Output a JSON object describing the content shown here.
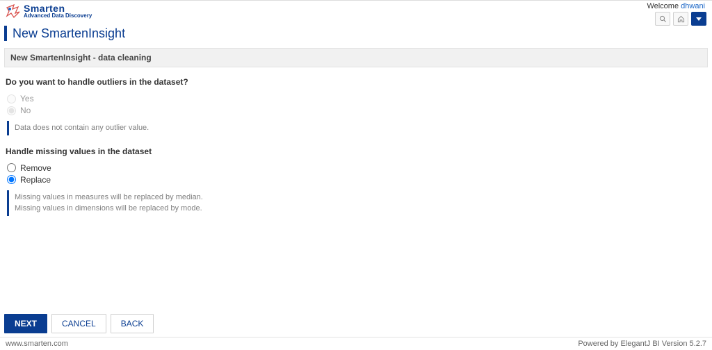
{
  "header": {
    "brand_name": "Smarten",
    "brand_tag": "Advanced Data Discovery",
    "welcome_prefix": "Welcome ",
    "username": "dhwani"
  },
  "page": {
    "title": "New SmartenInsight",
    "section_title": "New SmartenInsight - data cleaning"
  },
  "outliers": {
    "question": "Do you want to handle outliers in the dataset?",
    "options": {
      "yes": "Yes",
      "no": "No"
    },
    "selected": "no",
    "info": "Data does not contain any outlier value."
  },
  "missing": {
    "question": "Handle missing values in the dataset",
    "options": {
      "remove": "Remove",
      "replace": "Replace"
    },
    "selected": "replace",
    "info_line1": "Missing values in measures will be replaced by median.",
    "info_line2": "Missing values in dimensions will be replaced by mode."
  },
  "buttons": {
    "next": "NEXT",
    "cancel": "CANCEL",
    "back": "BACK"
  },
  "footer": {
    "url": "www.smarten.com",
    "version": "Powered by ElegantJ BI Version 5.2.7"
  }
}
